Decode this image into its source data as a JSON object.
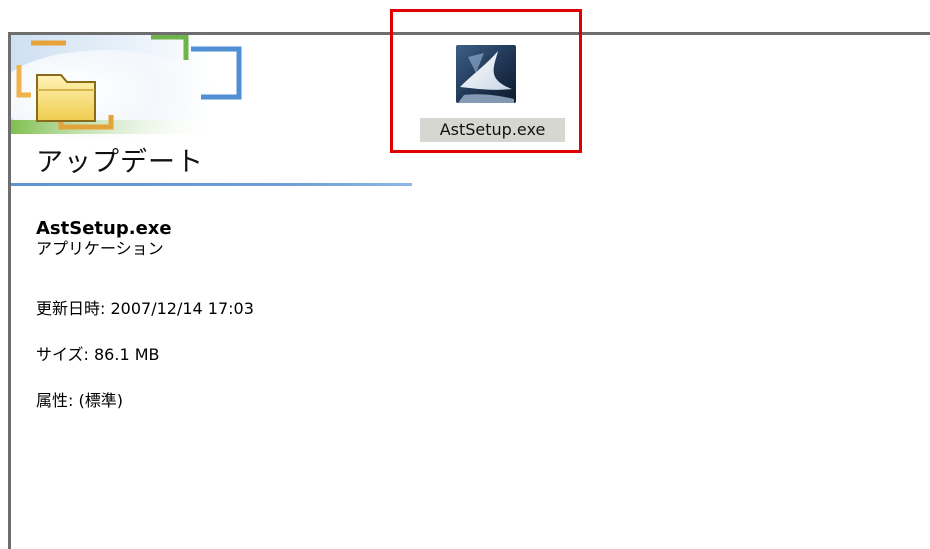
{
  "panel": {
    "title": "アップデート"
  },
  "details": {
    "file_name": "AstSetup.exe",
    "file_type": "アプリケーション",
    "modified": "更新日時: 2007/12/14 17:03",
    "size": "サイズ: 86.1 MB",
    "attributes": "属性: (標準)"
  },
  "file_icon": {
    "caption": "AstSetup.exe",
    "icon": "installer-app-icon"
  },
  "highlight": {
    "color": "#e00000"
  },
  "colors": {
    "border": "#6e6e6e",
    "accent_rule": "#5f94cf",
    "selection": "#d7d7d2"
  }
}
